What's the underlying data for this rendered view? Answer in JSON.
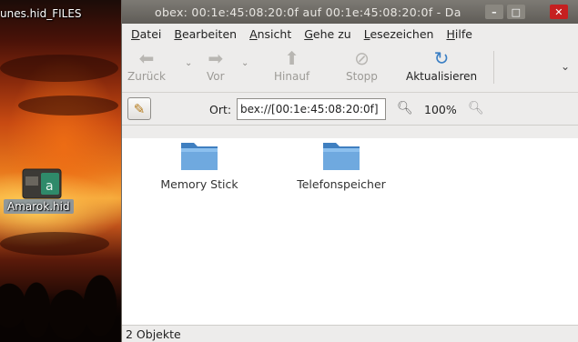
{
  "desktop": {
    "top_icon_label": "unes.hid_FILES",
    "amarok_label": "Amarok.hid"
  },
  "window": {
    "title": "obex: 00:1e:45:08:20:0f auf 00:1e:45:08:20:0f - Da",
    "buttons": {
      "minimize": "–",
      "maximize": "□",
      "close": "✕"
    }
  },
  "menubar": [
    {
      "ul": "D",
      "rest": "atei"
    },
    {
      "ul": "B",
      "rest": "earbeiten"
    },
    {
      "ul": "A",
      "rest": "nsicht"
    },
    {
      "ul": "G",
      "rest": "ehe zu"
    },
    {
      "ul": "L",
      "rest": "esezeichen"
    },
    {
      "ul": "H",
      "rest": "ilfe"
    }
  ],
  "toolbar": {
    "back_label": "Zurück",
    "forward_label": "Vor",
    "up_label": "Hinauf",
    "stop_label": "Stopp",
    "reload_label": "Aktualisieren"
  },
  "location": {
    "label": "Ort:",
    "value": "bex://[00:1e:45:08:20:0f]",
    "zoom": "100%"
  },
  "folders": [
    {
      "name": "Memory Stick"
    },
    {
      "name": "Telefonspeicher"
    }
  ],
  "status": "2 Objekte",
  "colors": {
    "folder": "#5b9bd5",
    "accent": "#3b7fc4",
    "close": "#c62020"
  }
}
